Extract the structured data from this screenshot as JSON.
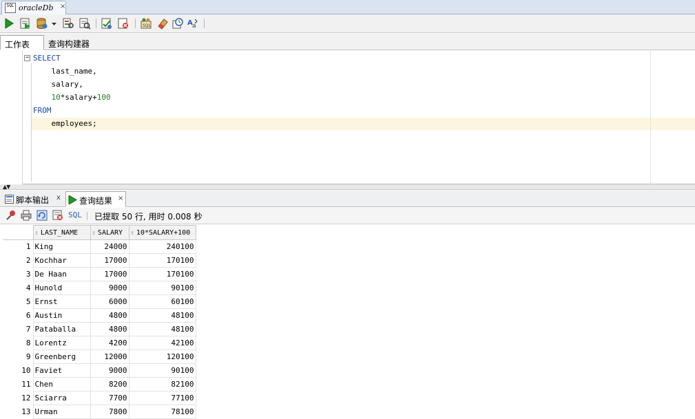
{
  "doc_tab": {
    "title": "oracleDb",
    "icon": "sql-file-icon",
    "icon_text": "SQL",
    "close": "×"
  },
  "toolbar": {
    "buttons": [
      "run-statement-icon",
      "run-script-icon",
      "commit-icon",
      "dropdown-arrow-icon",
      "explain-plan-icon",
      "autotrace-icon",
      "commit-transaction-icon",
      "rollback-icon",
      "sql-tuning-icon",
      "clear-icon",
      "history-icon",
      "format-icon"
    ]
  },
  "worksheet_tabs": [
    "工作表",
    "查询构建器"
  ],
  "editor": {
    "lines": [
      {
        "kw": "SELECT"
      },
      {
        "text": "    last_name,"
      },
      {
        "text": "    salary,"
      },
      {
        "num1": "10",
        "text": "*salary+",
        "num2": "100"
      },
      {
        "kw": "FROM"
      },
      {
        "text": "    employees;"
      }
    ]
  },
  "result_tabs": [
    {
      "label": "脚本输出",
      "close": "x"
    },
    {
      "label": "查询结果",
      "close": "×"
    }
  ],
  "result_toolbar": {
    "sql_link": "SQL",
    "status": "已提取 50 行, 用时 0.008 秒"
  },
  "grid": {
    "columns": [
      "LAST_NAME",
      "SALARY",
      "10*SALARY+100"
    ],
    "rows": [
      [
        "1",
        "King",
        "24000",
        "240100"
      ],
      [
        "2",
        "Kochhar",
        "17000",
        "170100"
      ],
      [
        "3",
        "De Haan",
        "17000",
        "170100"
      ],
      [
        "4",
        "Hunold",
        "9000",
        "90100"
      ],
      [
        "5",
        "Ernst",
        "6000",
        "60100"
      ],
      [
        "6",
        "Austin",
        "4800",
        "48100"
      ],
      [
        "7",
        "Pataballa",
        "4800",
        "48100"
      ],
      [
        "8",
        "Lorentz",
        "4200",
        "42100"
      ],
      [
        "9",
        "Greenberg",
        "12000",
        "120100"
      ],
      [
        "10",
        "Faviet",
        "9000",
        "90100"
      ],
      [
        "11",
        "Chen",
        "8200",
        "82100"
      ],
      [
        "12",
        "Sciarra",
        "7700",
        "77100"
      ],
      [
        "13",
        "Urman",
        "7800",
        "78100"
      ]
    ]
  },
  "colors": {
    "keyword": "#1a4aa8",
    "number": "#2b7a2b",
    "current_line": "#fcf6e0",
    "run_green": "#1f9a1f"
  }
}
